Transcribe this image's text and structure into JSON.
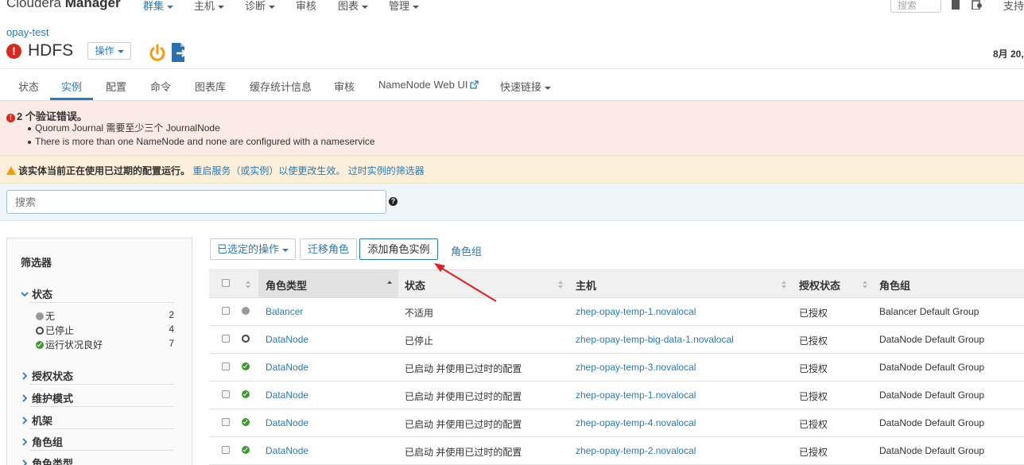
{
  "app": {
    "brand_light": "Cloudera ",
    "brand_bold": "Manager"
  },
  "topnav": {
    "items": [
      {
        "label": "群集",
        "active": true,
        "caret": true
      },
      {
        "label": "主机",
        "active": false,
        "caret": true
      },
      {
        "label": "诊断",
        "active": false,
        "caret": true
      },
      {
        "label": "审核",
        "active": false,
        "caret": false
      },
      {
        "label": "图表",
        "active": false,
        "caret": true
      },
      {
        "label": "管理",
        "active": false,
        "caret": true
      }
    ],
    "search_placeholder": "搜索",
    "support_label": "支持"
  },
  "header": {
    "cluster_name": "opay-test",
    "service_name": "HDFS",
    "actions_label": "操作",
    "date_text": "8月 20,"
  },
  "tabs": [
    {
      "label": "状态"
    },
    {
      "label": "实例"
    },
    {
      "label": "配置"
    },
    {
      "label": "命令"
    },
    {
      "label": "图表库"
    },
    {
      "label": "缓存统计信息"
    },
    {
      "label": "审核"
    },
    {
      "label": "NameNode Web UI"
    },
    {
      "label": "快速链接"
    }
  ],
  "validation_alert": {
    "count": "2",
    "title_suffix": " 个验证错误。",
    "items": [
      "Quorum Journal 需要至少三个 JournalNode",
      "There is more than one NameNode and none are configured with a nameservice"
    ]
  },
  "stale_alert": {
    "text": "该实体当前正在使用已过期的配置运行。",
    "link1": "重启服务（或实例）以使更改生效。",
    "link2": "过时实例的筛选器"
  },
  "search": {
    "placeholder": "搜索"
  },
  "filters": {
    "title": "筛选器",
    "status_section": "状态",
    "status_items": [
      {
        "label": "无",
        "count": "2"
      },
      {
        "label": "已停止",
        "count": "4"
      },
      {
        "label": "运行状况良好",
        "count": "7"
      }
    ],
    "sections": [
      "授权状态",
      "维护模式",
      "机架",
      "角色组",
      "角色类型"
    ]
  },
  "toolbar": {
    "selected_actions": "已选定的操作",
    "migrate_roles": "迁移角色",
    "add_role_instances": "添加角色实例",
    "role_groups": "角色组"
  },
  "table": {
    "headers": {
      "role_type": "角色类型",
      "status": "状态",
      "host": "主机",
      "commission": "授权状态",
      "role_group": "角色组"
    },
    "rows": [
      {
        "health": "none",
        "role_type": "Balancer",
        "status": "不适用",
        "host": "zhep-opay-temp-1.novalocal",
        "commission": "已授权",
        "role_group": "Balancer Default Group"
      },
      {
        "health": "stopped",
        "role_type": "DataNode",
        "status": "已停止",
        "host": "zhep-opay-temp-big-data-1.novalocal",
        "commission": "已授权",
        "role_group": "DataNode Default Group"
      },
      {
        "health": "good",
        "role_type": "DataNode",
        "status": "已启动 并使用已过时的配置",
        "host": "zhep-opay-temp-3.novalocal",
        "commission": "已授权",
        "role_group": "DataNode Default Group"
      },
      {
        "health": "good",
        "role_type": "DataNode",
        "status": "已启动 并使用已过时的配置",
        "host": "zhep-opay-temp-1.novalocal",
        "commission": "已授权",
        "role_group": "DataNode Default Group"
      },
      {
        "health": "good",
        "role_type": "DataNode",
        "status": "已启动 并使用已过时的配置",
        "host": "zhep-opay-temp-4.novalocal",
        "commission": "已授权",
        "role_group": "DataNode Default Group"
      },
      {
        "health": "good",
        "role_type": "DataNode",
        "status": "已启动 并使用已过时的配置",
        "host": "zhep-opay-temp-2.novalocal",
        "commission": "已授权",
        "role_group": "DataNode Default Group"
      }
    ]
  },
  "colors": {
    "link": "#2a7ab8",
    "error": "#d9291c",
    "warning": "#f0a000",
    "good": "#3b9b2d",
    "annotation_arrow": "#e02020"
  }
}
